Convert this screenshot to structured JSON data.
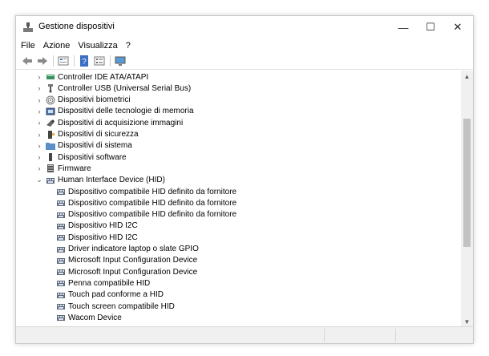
{
  "window": {
    "title": "Gestione dispositivi"
  },
  "controls": {
    "minimize": "—",
    "maximize": "☐",
    "close": "✕"
  },
  "menu": [
    "File",
    "Azione",
    "Visualizza",
    "?"
  ],
  "toolbar": [
    "back-icon",
    "forward-icon",
    "properties-icon",
    "help-icon",
    "view-icon",
    "monitor-icon"
  ],
  "tree": [
    {
      "label": "Controller IDE ATA/ATAPI",
      "expanded": false,
      "icon": "ide-controller-icon"
    },
    {
      "label": "Controller USB (Universal Serial Bus)",
      "expanded": false,
      "icon": "usb-icon"
    },
    {
      "label": "Dispositivi biometrici",
      "expanded": false,
      "icon": "fingerprint-icon"
    },
    {
      "label": "Dispositivi delle tecnologie di memoria",
      "expanded": false,
      "icon": "memory-icon"
    },
    {
      "label": "Dispositivi di acquisizione immagini",
      "expanded": false,
      "icon": "camera-icon"
    },
    {
      "label": "Dispositivi di sicurezza",
      "expanded": false,
      "icon": "security-icon"
    },
    {
      "label": "Dispositivi di sistema",
      "expanded": false,
      "icon": "system-folder-icon"
    },
    {
      "label": "Dispositivi software",
      "expanded": false,
      "icon": "software-device-icon"
    },
    {
      "label": "Firmware",
      "expanded": false,
      "icon": "firmware-icon"
    },
    {
      "label": "Human Interface Device (HID)",
      "expanded": true,
      "icon": "hid-icon"
    }
  ],
  "hid_children": [
    "Dispositivo compatibile HID definito da fornitore",
    "Dispositivo compatibile HID definito da fornitore",
    "Dispositivo compatibile HID definito da fornitore",
    "Dispositivo HID I2C",
    "Dispositivo HID I2C",
    "Driver indicatore laptop o slate GPIO",
    "Microsoft Input Configuration Device",
    "Microsoft Input Configuration Device",
    "Penna compatibile HID",
    "Touch pad conforme a HID",
    "Touch screen compatibile HID",
    "Wacom Device"
  ],
  "colors": {
    "accent": "#0067c0",
    "hid_icon": "#5a6b7a"
  }
}
